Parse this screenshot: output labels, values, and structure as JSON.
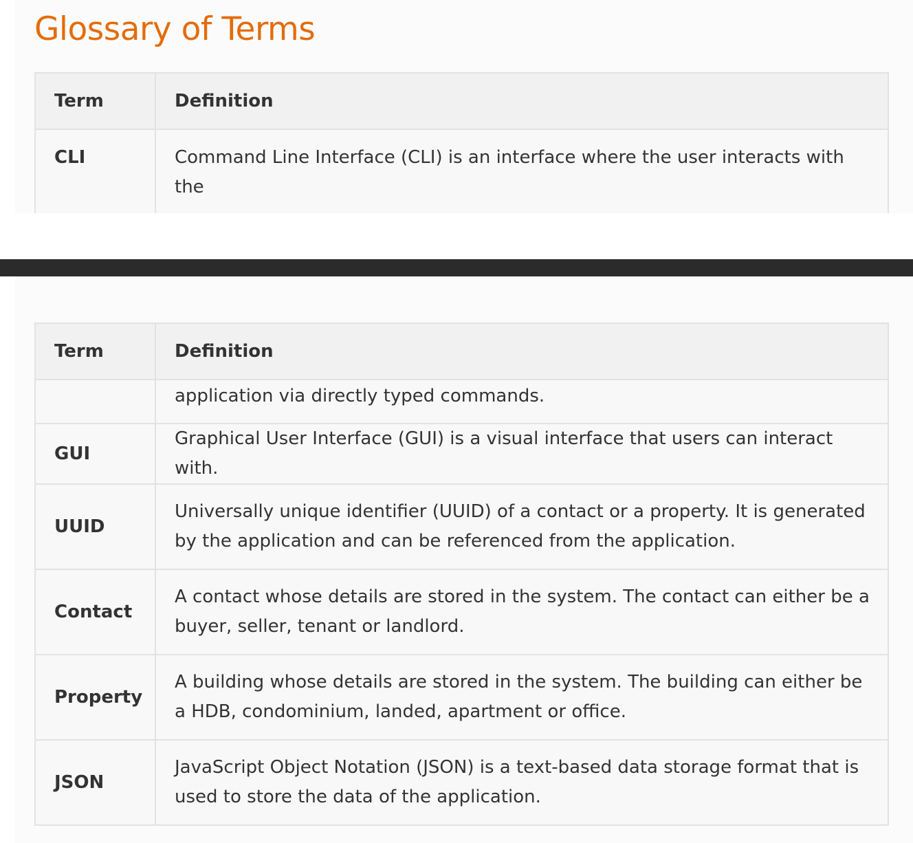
{
  "page": {
    "title": "Glossary of Terms"
  },
  "table": {
    "headers": {
      "term": "Term",
      "definition": "Definition"
    },
    "top_fragment": {
      "term": "CLI",
      "definition_start": "Command Line Interface (CLI) is an interface where the user interacts with the"
    },
    "bottom_fragment": {
      "definition_continued": "application via directly typed commands.",
      "rows": [
        {
          "term": "GUI",
          "definition": "Graphical User Interface (GUI) is a visual interface that users can interact with."
        },
        {
          "term": "UUID",
          "definition": "Universally unique identifier (UUID) of a contact or a property. It is generated by the application and can be referenced from the application."
        },
        {
          "term": "Contact",
          "definition": "A contact whose details are stored in the system. The contact can either be a buyer, seller, tenant or landlord."
        },
        {
          "term": "Property",
          "definition": "A building whose details are stored in the system. The building can either be a HDB, condominium, landed, apartment or office."
        },
        {
          "term": "JSON",
          "definition": "JavaScript Object Notation (JSON) is a text-based data storage format that is used to store the data of the application."
        }
      ]
    }
  },
  "colors": {
    "title": "#e46c0a",
    "header_bg": "#f1f1f1",
    "cell_bg": "#f8f8f8",
    "border": "#e2e2e2",
    "divider": "#2b2b2b"
  }
}
